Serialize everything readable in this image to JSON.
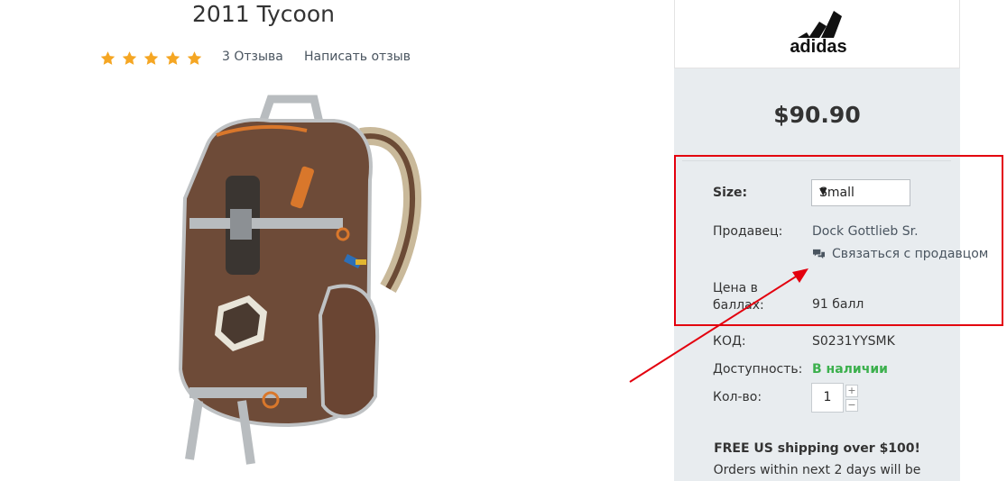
{
  "product": {
    "title": "2011 Tycoon",
    "rating_stars": 5,
    "reviews_link": "3 Отзыва",
    "write_review_link": "Написать отзыв",
    "image_name": "brown-backpack-image"
  },
  "brand": {
    "logo_text": "adidas"
  },
  "purchase": {
    "price": "$90.90",
    "size_label": "Size:",
    "size_value": "Small",
    "seller_label": "Продавец:",
    "seller_name": "Dock Gottlieb Sr.",
    "contact_seller": "Связаться с продавцом",
    "points_label": "Цена в баллах:",
    "points_label_line1": "Цена в",
    "points_label_line2": "баллах:",
    "points_value": "91 балл",
    "code_label": "КОД:",
    "code_value": "S0231YYSMK",
    "availability_label": "Доступность:",
    "availability_value": "В наличии",
    "qty_label": "Кол-во:",
    "qty_value": "1",
    "qty_plus": "+",
    "qty_minus": "−",
    "shipping_line1": "FREE US shipping over $100!",
    "shipping_line2": "Orders within next 2 days will be"
  },
  "colors": {
    "star": "#f5a623",
    "panel_bg": "#e8ecef",
    "highlight_red": "#e3000e",
    "in_stock_green": "#3cb04d"
  }
}
